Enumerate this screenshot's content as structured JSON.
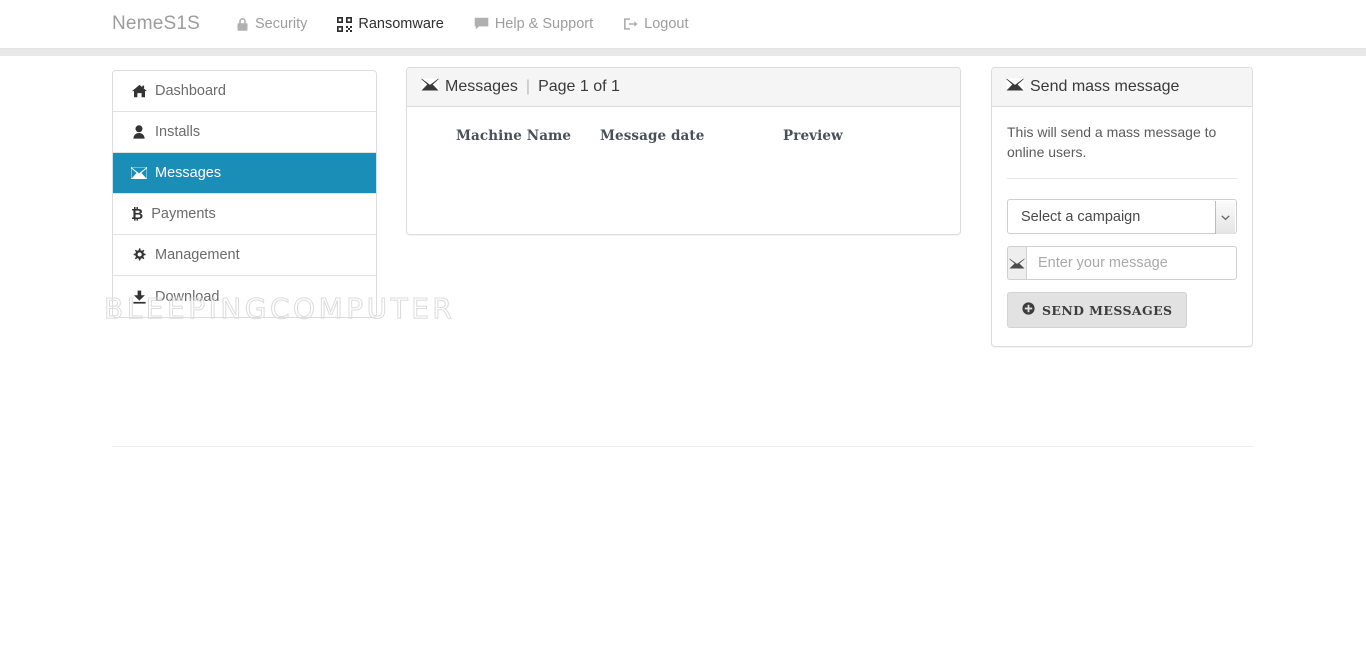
{
  "navbar": {
    "brand": "NemeS1S",
    "links": [
      {
        "label": "Security",
        "icon": "lock-icon",
        "active": false
      },
      {
        "label": "Ransomware",
        "icon": "qrcode-icon",
        "active": true
      },
      {
        "label": "Help & Support",
        "icon": "comment-icon",
        "active": false
      },
      {
        "label": "Logout",
        "icon": "sign-out-icon",
        "active": false
      }
    ]
  },
  "sidebar": {
    "items": [
      {
        "label": "Dashboard",
        "icon": "home-icon",
        "active": false
      },
      {
        "label": "Installs",
        "icon": "user-icon",
        "active": false
      },
      {
        "label": "Messages",
        "icon": "envelope-icon",
        "active": true
      },
      {
        "label": "Payments",
        "icon": "bitcoin-icon",
        "active": false
      },
      {
        "label": "Management",
        "icon": "gear-icon",
        "active": false
      },
      {
        "label": "Download",
        "icon": "download-icon",
        "active": false
      }
    ]
  },
  "messages_panel": {
    "title": "Messages",
    "separator": "|",
    "page_label": "Page 1 of 1",
    "icon": "envelope-icon",
    "columns": [
      "Machine Name",
      "Message date",
      "Preview"
    ],
    "rows": []
  },
  "send_panel": {
    "title": "Send mass message",
    "icon": "envelope-icon",
    "description": "This will send a mass message to online users.",
    "campaign_select": {
      "value": "Select a campaign",
      "icon": "chevron-down-icon"
    },
    "message_input": {
      "placeholder": "Enter your message",
      "value": "",
      "addon_icon": "envelope-icon"
    },
    "send_button": {
      "label": "SEND MESSAGES",
      "icon": "plus-circle-icon"
    }
  },
  "watermark": {
    "text": "BLEEPINGCOMPUTER"
  },
  "colors": {
    "accent": "#1b8eb7",
    "panel_header_bg": "#f5f5f5",
    "border": "#dddddd",
    "nav_text": "#9d9d9d",
    "body_text": "#5b5b5b"
  }
}
